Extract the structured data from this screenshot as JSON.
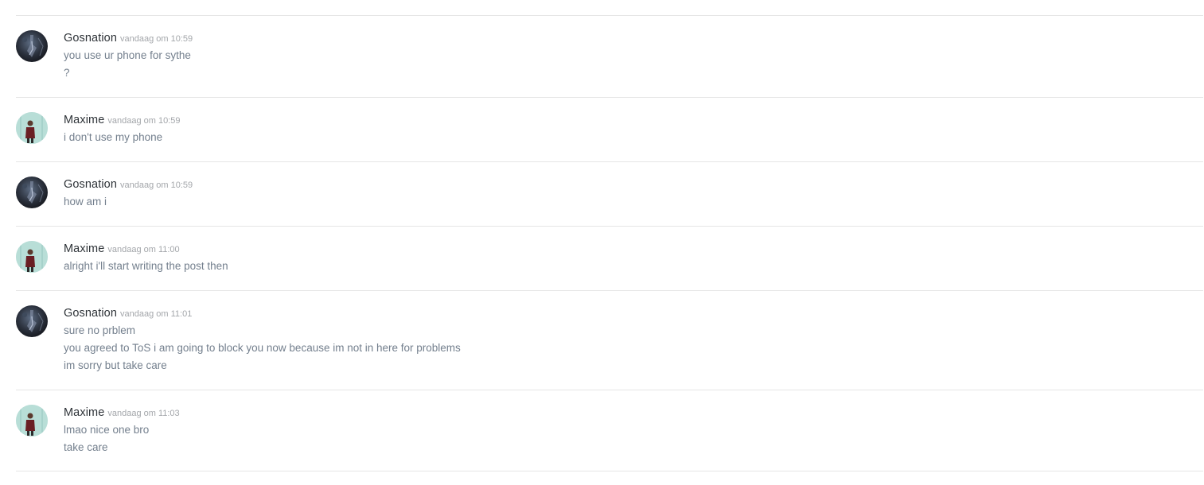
{
  "messages": [
    {
      "username": "Gosnation",
      "timestamp": "vandaag om 10:59",
      "lines": [
        "you use ur phone for sythe",
        "?"
      ]
    },
    {
      "username": "Maxime",
      "timestamp": "vandaag om 10:59",
      "lines": [
        "i don't use my phone"
      ]
    },
    {
      "username": "Gosnation",
      "timestamp": "vandaag om 10:59",
      "lines": [
        "how am i"
      ]
    },
    {
      "username": "Maxime",
      "timestamp": "vandaag om 11:00",
      "lines": [
        "alright i'll start writing the post then"
      ]
    },
    {
      "username": "Gosnation",
      "timestamp": "vandaag om 11:01",
      "lines": [
        "sure no prblem",
        "you agreed to ToS i am going to block you now because im not in here for problems",
        "im sorry but take care"
      ]
    },
    {
      "username": "Maxime",
      "timestamp": "vandaag om 11:03",
      "lines": [
        "lmao nice one bro",
        "take care"
      ]
    }
  ]
}
